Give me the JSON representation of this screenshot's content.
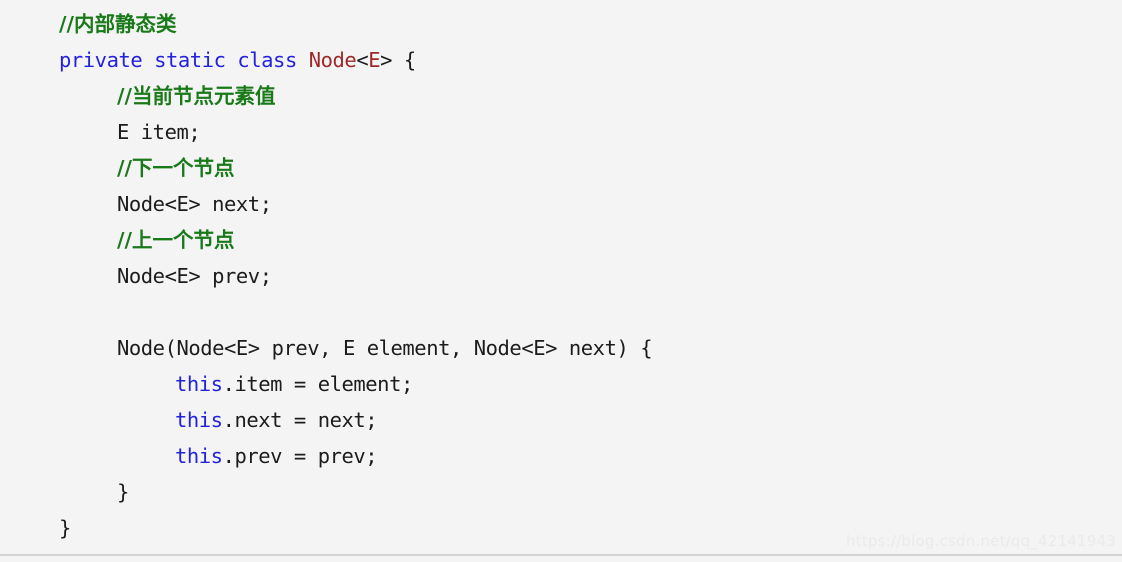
{
  "viewer": {
    "background_color": "#f4f4f4",
    "language": "Java",
    "watermark": "https://blog.csdn.net/qq_42141943",
    "rule_color": "#d2d2d2"
  },
  "theme": {
    "keyword_color": "#2222dd",
    "type_color": "#9c2a2a",
    "comment_color": "#1a7a1a",
    "plain_color": "#1c1c1c",
    "watermark_color": "#eaeaea"
  },
  "code": {
    "lines": [
      {
        "indent": 0,
        "text": "//内部静态类"
      },
      {
        "indent": 0,
        "text": "private static class Node<E> {"
      },
      {
        "indent": 1,
        "text": "//当前节点元素值"
      },
      {
        "indent": 1,
        "text": "E item;"
      },
      {
        "indent": 1,
        "text": "//下一个节点"
      },
      {
        "indent": 1,
        "text": "Node<E> next;"
      },
      {
        "indent": 1,
        "text": "//上一个节点"
      },
      {
        "indent": 1,
        "text": "Node<E> prev;"
      },
      {
        "indent": 0,
        "text": ""
      },
      {
        "indent": 1,
        "text": "Node(Node<E> prev, E element, Node<E> next) {"
      },
      {
        "indent": 2,
        "text": "this.item = element;"
      },
      {
        "indent": 2,
        "text": "this.next = next;"
      },
      {
        "indent": 2,
        "text": "this.prev = prev;"
      },
      {
        "indent": 1,
        "text": "}"
      },
      {
        "indent": 0,
        "text": "}"
      }
    ],
    "tokens": {
      "line_0": [
        {
          "t": "//内部静态类",
          "c": "comment"
        }
      ],
      "line_1": [
        {
          "t": "private static class ",
          "c": "keyword"
        },
        {
          "t": "Node",
          "c": "type"
        },
        {
          "t": "<",
          "c": "plain"
        },
        {
          "t": "E",
          "c": "type"
        },
        {
          "t": "> {",
          "c": "plain"
        }
      ],
      "line_2": [
        {
          "t": "//当前节点元素值",
          "c": "comment"
        }
      ],
      "line_3": [
        {
          "t": "E item;",
          "c": "plain"
        }
      ],
      "line_4": [
        {
          "t": "//下一个节点",
          "c": "comment"
        }
      ],
      "line_5": [
        {
          "t": "Node<E> next;",
          "c": "plain"
        }
      ],
      "line_6": [
        {
          "t": "//上一个节点",
          "c": "comment"
        }
      ],
      "line_7": [
        {
          "t": "Node<E> prev;",
          "c": "plain"
        }
      ],
      "line_8": [],
      "line_9": [
        {
          "t": "Node(Node<E> prev, E element, Node<E> next) {",
          "c": "plain"
        }
      ],
      "line_10": [
        {
          "t": "this",
          "c": "keyword"
        },
        {
          "t": ".item = element;",
          "c": "plain"
        }
      ],
      "line_11": [
        {
          "t": "this",
          "c": "keyword"
        },
        {
          "t": ".next = next;",
          "c": "plain"
        }
      ],
      "line_12": [
        {
          "t": "this",
          "c": "keyword"
        },
        {
          "t": ".prev = prev;",
          "c": "plain"
        }
      ],
      "line_13": [
        {
          "t": "}",
          "c": "plain"
        }
      ],
      "line_14": [
        {
          "t": "}",
          "c": "plain"
        }
      ]
    }
  }
}
